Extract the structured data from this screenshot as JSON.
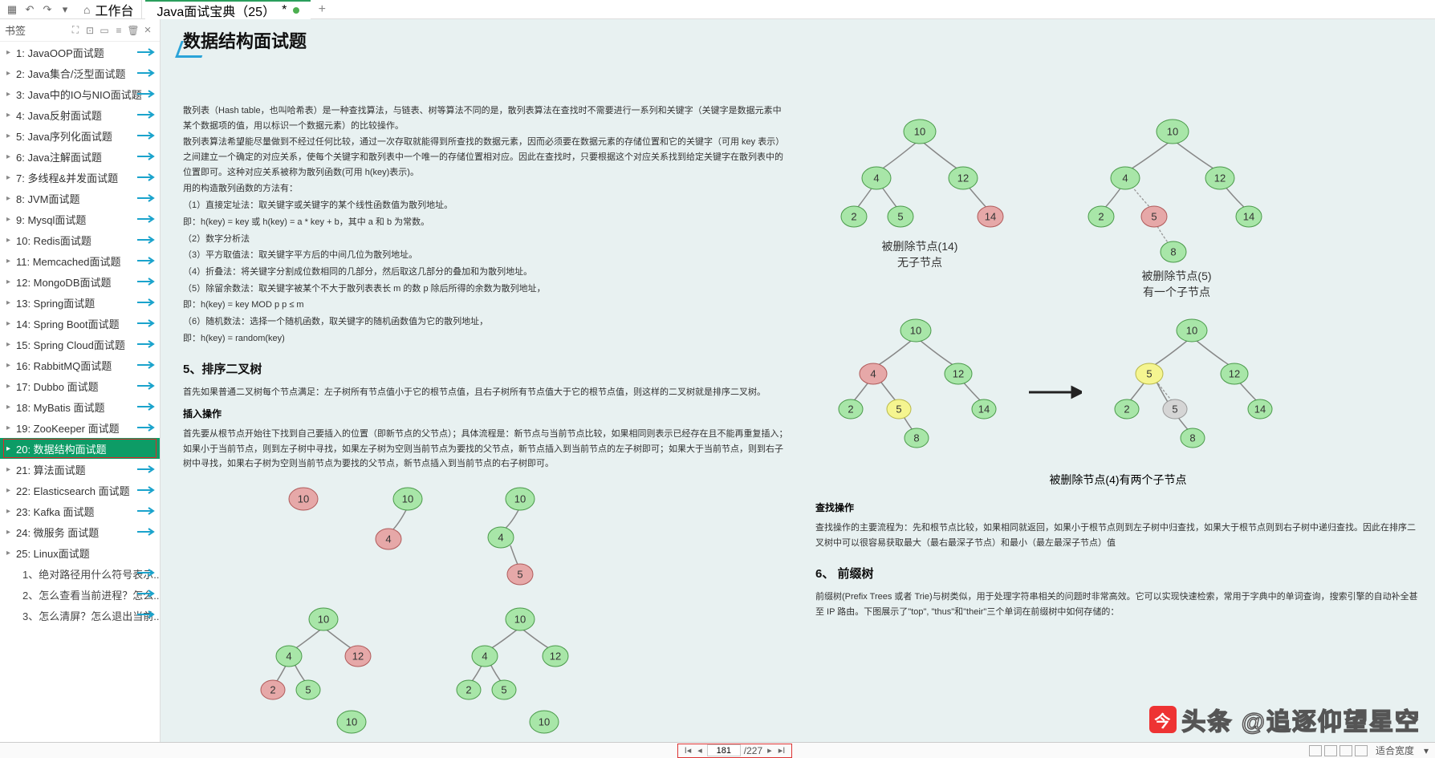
{
  "topbar": {
    "home_label": "工作台",
    "tab_label": "Java面试宝典（25）",
    "tab_dirty": "*"
  },
  "sidebar": {
    "title": "书签",
    "items": [
      {
        "label": "1: JavaOOP面试题",
        "expand": true,
        "hint": true
      },
      {
        "label": "2: Java集合/泛型面试题",
        "expand": true,
        "hint": true
      },
      {
        "label": "3: Java中的IO与NIO面试题",
        "expand": true,
        "hint": true
      },
      {
        "label": "4: Java反射面试题",
        "expand": true,
        "hint": true
      },
      {
        "label": "5: Java序列化面试题",
        "expand": true,
        "hint": true
      },
      {
        "label": "6: Java注解面试题",
        "expand": true,
        "hint": true
      },
      {
        "label": "7: 多线程&并发面试题",
        "expand": true,
        "hint": true
      },
      {
        "label": "8: JVM面试题",
        "expand": true,
        "hint": true
      },
      {
        "label": "9: Mysql面试题",
        "expand": true,
        "hint": true
      },
      {
        "label": "10: Redis面试题",
        "expand": true,
        "hint": true
      },
      {
        "label": "11: Memcached面试题",
        "expand": true,
        "hint": true
      },
      {
        "label": "12: MongoDB面试题",
        "expand": true,
        "hint": true
      },
      {
        "label": "13: Spring面试题",
        "expand": true,
        "hint": true
      },
      {
        "label": "14: Spring Boot面试题",
        "expand": true,
        "hint": true
      },
      {
        "label": "15: Spring Cloud面试题",
        "expand": true,
        "hint": true
      },
      {
        "label": "16: RabbitMQ面试题",
        "expand": true,
        "hint": true
      },
      {
        "label": "17: Dubbo 面试题",
        "expand": true,
        "hint": true
      },
      {
        "label": "18: MyBatis 面试题",
        "expand": true,
        "hint": true
      },
      {
        "label": "19: ZooKeeper 面试题",
        "expand": true,
        "hint": true
      },
      {
        "label": "20: 数据结构面试题",
        "expand": true,
        "sel": true,
        "hl": true
      },
      {
        "label": "21: 算法面试题",
        "expand": true,
        "hint": true
      },
      {
        "label": "22: Elasticsearch 面试题",
        "expand": true,
        "hint": true
      },
      {
        "label": "23: Kafka 面试题",
        "expand": true,
        "hint": true
      },
      {
        "label": "24: 微服务 面试题",
        "expand": true,
        "hint": true
      },
      {
        "label": "25: Linux面试题",
        "expand": true
      }
    ],
    "subs": [
      {
        "label": "1、绝对路径用什么符号表示..."
      },
      {
        "label": "2、怎么查看当前进程？怎么..."
      },
      {
        "label": "3、怎么清屏？怎么退出当前..."
      }
    ]
  },
  "doc": {
    "h1": "数据结构面试题",
    "hash_intro": [
      "散列表（Hash table，也叫哈希表）是一种查找算法，与链表、树等算法不同的是，散列表算法在查找时不需要进行一系列和关键字（关键字是数据元素中某个数据项的值，用以标识一个数据元素）的比较操作。",
      "散列表算法希望能尽量做到不经过任何比较，通过一次存取就能得到所查找的数据元素，因而必须要在数据元素的存储位置和它的关键字（可用 key 表示）之间建立一个确定的对应关系，使每个关键字和散列表中一个唯一的存储位置相对应。因此在查找时，只要根据这个对应关系找到给定关键字在散列表中的位置即可。这种对应关系被称为散列函数(可用 h(key)表示)。",
      "用的构造散列函数的方法有：",
      "（1）直接定址法：取关键字或关键字的某个线性函数值为散列地址。",
      "即：h(key) = key 或 h(key) = a * key + b，其中 a 和 b 为常数。",
      "（2）数字分析法",
      "（3）平方取值法：取关键字平方后的中间几位为散列地址。",
      "（4）折叠法：将关键字分割成位数相同的几部分，然后取这几部分的叠加和为散列地址。",
      "（5）除留余数法：取关键字被某个不大于散列表表长 m 的数 p 除后所得的余数为散列地址，",
      "即：h(key) = key MOD p  p ≤ m",
      "（6）随机数法：选择一个随机函数，取关键字的随机函数值为它的散列地址，",
      "即：h(key) = random(key)"
    ],
    "h3_sort": "5、排序二叉树",
    "sort_p": "首先如果普通二叉树每个节点满足：左子树所有节点值小于它的根节点值，且右子树所有节点值大于它的根节点值，则这样的二叉树就是排序二叉树。",
    "h4_insert": "插入操作",
    "insert_p": "首先要从根节点开始往下找到自己要插入的位置（即新节点的父节点）；具体流程是：新节点与当前节点比较，如果相同则表示已经存在且不能再重复插入；如果小于当前节点，则到左子树中寻找，如果左子树为空则当前节点为要找的父节点，新节点插入到当前节点的左子树即可；如果大于当前节点，则到右子树中寻找，如果右子树为空则当前节点为要找的父节点，新节点插入到当前节点的右子树即可。",
    "h4_search": "查找操作",
    "search_p": "查找操作的主要流程为：先和根节点比较，如果相同就返回，如果小于根节点则到左子树中归查找，如果大于根节点则到右子树中递归查找。因此在排序二叉树中可以很容易获取最大（最右最深子节点）和最小（最左最深子节点）值",
    "h3_trie": "6、 前缀树",
    "trie_p": "前缀树(Prefix Trees 或者 Trie)与树类似，用于处理字符串相关的问题时非常高效。它可以实现快速检索，常用于字典中的单词查询，搜索引擎的自动补全甚至 IP 路由。下图展示了\"top\", \"thus\"和\"their\"三个单词在前缀树中如何存储的：",
    "fig_cap1": "被删除节点(14)\n无子节点",
    "fig_cap2": "被删除节点(5)\n有一个子节点",
    "fig_cap3": "被删除节点(4)有两个子节点"
  },
  "pager": {
    "current": "181",
    "total": "/227"
  },
  "status": {
    "fit": "适合宽度"
  },
  "watermark": "头条 @追逐仰望星空"
}
